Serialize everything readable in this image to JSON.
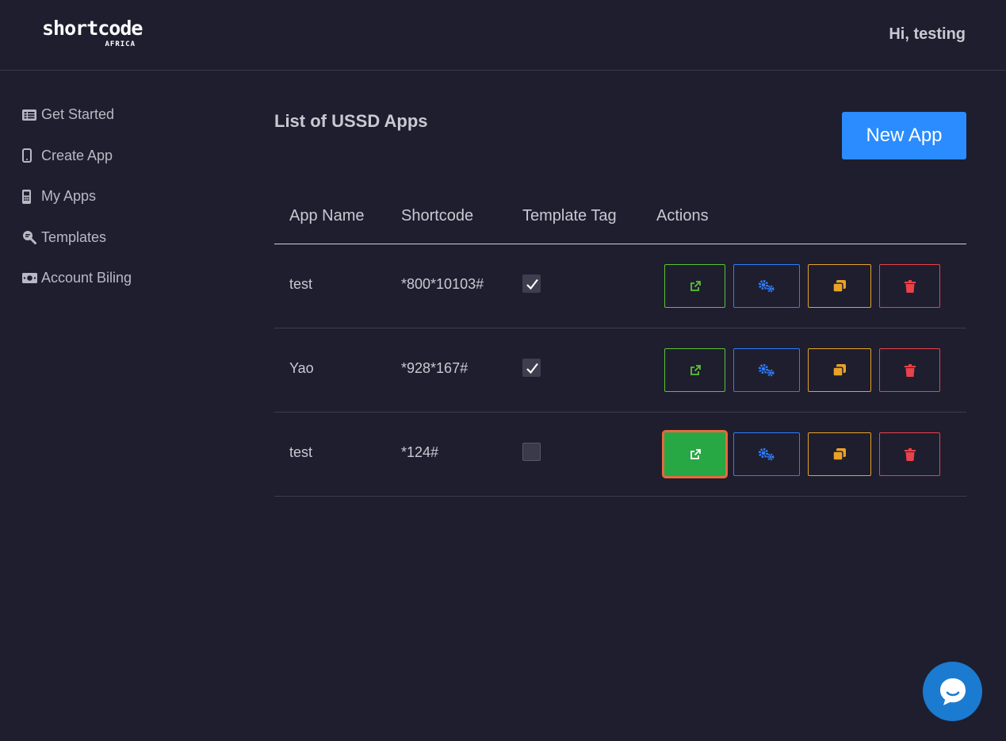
{
  "header": {
    "logo_main": "shortcode",
    "logo_sub": "AFRICA",
    "greeting": "Hi, testing"
  },
  "sidebar": {
    "items": [
      {
        "label": "Get Started",
        "icon": "list-icon"
      },
      {
        "label": "Create App",
        "icon": "mobile-icon"
      },
      {
        "label": "My Apps",
        "icon": "mobile-alt-icon"
      },
      {
        "label": "Templates",
        "icon": "search-template-icon"
      },
      {
        "label": "Account Biling",
        "icon": "money-bill-icon"
      }
    ]
  },
  "main": {
    "title": "List of USSD Apps",
    "new_app_label": "New App",
    "table": {
      "columns": [
        "App Name",
        "Shortcode",
        "Template Tag",
        "Actions"
      ],
      "rows": [
        {
          "name": "test",
          "shortcode": "*800*10103#",
          "template": true
        },
        {
          "name": "Yao",
          "shortcode": "*928*167#",
          "template": true
        },
        {
          "name": "test",
          "shortcode": "*124#",
          "template": false
        }
      ]
    }
  },
  "colors": {
    "background": "#1f1e2f",
    "primary": "#2a8cff",
    "success": "#28a745",
    "info": "#2d7dff",
    "warning": "#e8a228",
    "danger": "#e8424a",
    "chat": "#1a7bd0"
  }
}
